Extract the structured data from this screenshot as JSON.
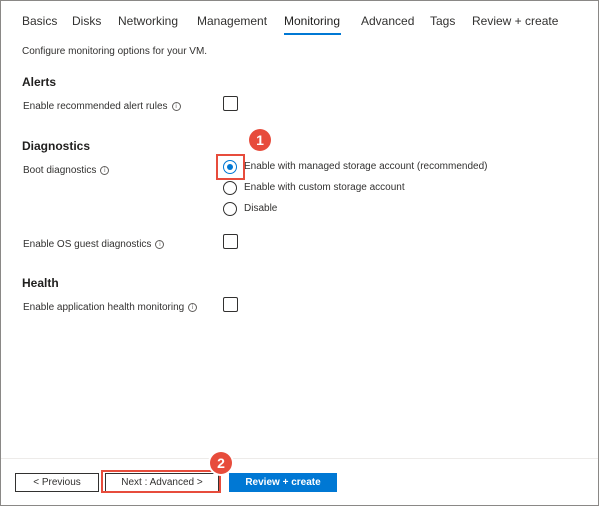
{
  "tabs": [
    {
      "label": "Basics"
    },
    {
      "label": "Disks"
    },
    {
      "label": "Networking"
    },
    {
      "label": "Management"
    },
    {
      "label": "Monitoring"
    },
    {
      "label": "Advanced"
    },
    {
      "label": "Tags"
    },
    {
      "label": "Review + create"
    }
  ],
  "active_tab": "Monitoring",
  "intro": "Configure monitoring options for your VM.",
  "alerts": {
    "title": "Alerts",
    "recommended_rules_label": "Enable recommended alert rules",
    "recommended_rules_checked": false
  },
  "diagnostics": {
    "title": "Diagnostics",
    "boot_label": "Boot diagnostics",
    "boot_options": [
      {
        "label": "Enable with managed storage account (recommended)",
        "selected": true
      },
      {
        "label": "Enable with custom storage account",
        "selected": false
      },
      {
        "label": "Disable",
        "selected": false
      }
    ],
    "os_guest_label": "Enable OS guest diagnostics",
    "os_guest_checked": false
  },
  "health": {
    "title": "Health",
    "app_monitoring_label": "Enable application health monitoring",
    "app_monitoring_checked": false
  },
  "footer": {
    "previous_label": "< Previous",
    "next_label": "Next : Advanced >",
    "review_label": "Review + create"
  },
  "annotations": {
    "step1": "1",
    "step2": "2",
    "color": "#e74c3c"
  },
  "colors": {
    "accent": "#0078d4",
    "text": "#323130"
  },
  "icons": {
    "info": "info-circle-icon"
  }
}
